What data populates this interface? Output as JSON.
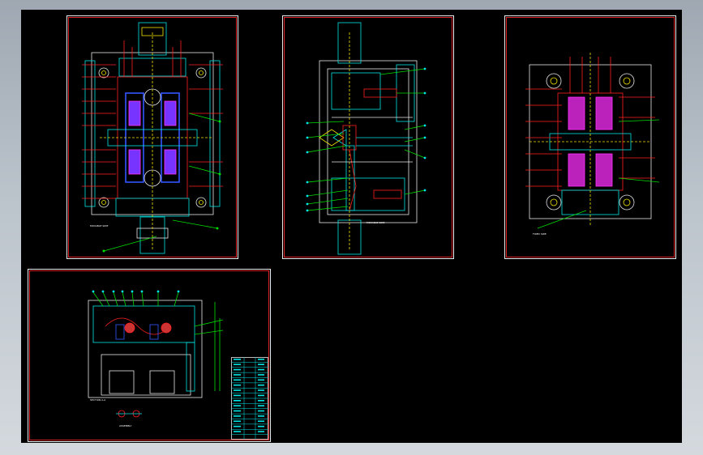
{
  "viewport": {
    "background": "#000000",
    "frame_color": "#dd2222",
    "line_colors": {
      "cyan": "#00e5e5",
      "red": "#ff2020",
      "yellow": "#f0e000",
      "green": "#00dd00",
      "blue": "#3355ff",
      "magenta": "#ff30ff",
      "white": "#e8e8e8"
    }
  },
  "sheets": [
    {
      "id": "top-view-left",
      "caption": "MOVABLE SIDE"
    },
    {
      "id": "side-section",
      "caption": "MOVABLE SIDE"
    },
    {
      "id": "top-view-right",
      "caption": "FIXED SIDE"
    },
    {
      "id": "assembly-section",
      "caption": "SECTION A-A",
      "sub_caption": "ASSEMBLY"
    }
  ],
  "title_block": {
    "rows": 16
  }
}
